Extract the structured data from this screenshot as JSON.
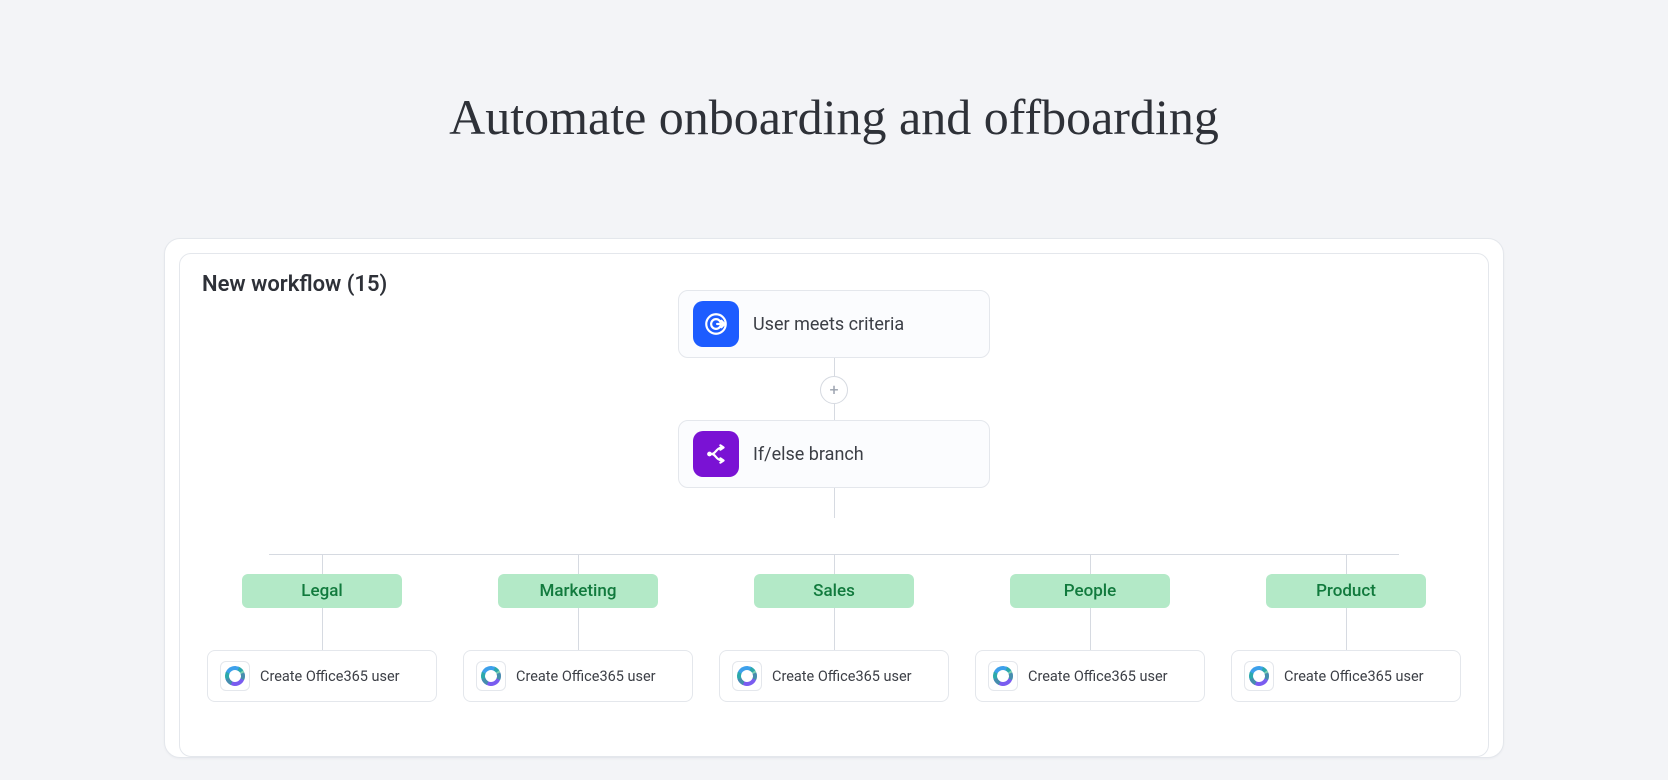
{
  "hero": "Automate onboarding and offboarding",
  "workflow": {
    "title": "New workflow (15)",
    "trigger": {
      "label": "User meets criteria"
    },
    "branch_node": {
      "label": "If/else branch"
    },
    "branches": [
      {
        "name": "Legal",
        "action": "Create Office365 user"
      },
      {
        "name": "Marketing",
        "action": "Create Office365 user"
      },
      {
        "name": "Sales",
        "action": "Create Office365 user"
      },
      {
        "name": "People",
        "action": "Create Office365 user"
      },
      {
        "name": "Product",
        "action": "Create Office365 user"
      }
    ]
  }
}
